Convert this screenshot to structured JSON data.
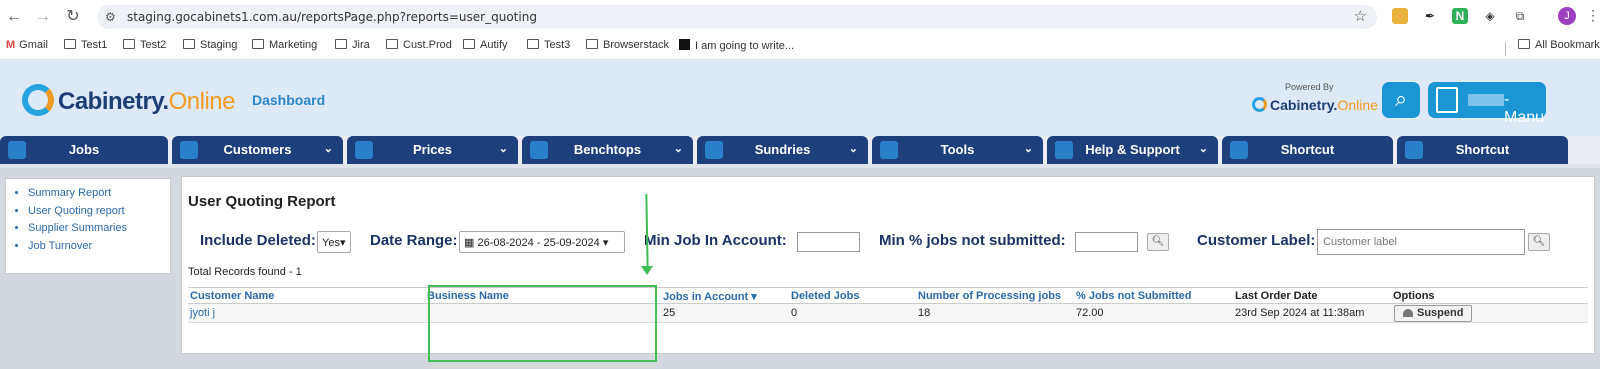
{
  "browser": {
    "url": "staging.gocabinets1.com.au/reportsPage.php?reports=user_quoting",
    "avatar_letter": "J",
    "bookmarks": [
      "Gmail",
      "Test1",
      "Test2",
      "Staging",
      "Marketing",
      "Jira",
      "Cust.Prod",
      "Autify",
      "Test3",
      "Browserstack",
      "I am going to write...",
      "All Bookmarks"
    ]
  },
  "header": {
    "logo_main": "Cabinetry.",
    "logo_accent": "Online",
    "dashboard_link": "Dashboard",
    "powered_by": "Powered By",
    "powered_logo_main": "Cabinetry.",
    "powered_logo_accent": "Online",
    "menu_label": "-Manu"
  },
  "nav": {
    "tabs": [
      {
        "label": "Jobs",
        "chevron": false
      },
      {
        "label": "Customers",
        "chevron": true
      },
      {
        "label": "Prices",
        "chevron": true
      },
      {
        "label": "Benchtops",
        "chevron": true
      },
      {
        "label": "Sundries",
        "chevron": true
      },
      {
        "label": "Tools",
        "chevron": true
      },
      {
        "label": "Help & Support",
        "chevron": true
      },
      {
        "label": "Shortcut",
        "chevron": false
      },
      {
        "label": "Shortcut",
        "chevron": false
      }
    ]
  },
  "sidebar": {
    "items": [
      "Summary Report",
      "User Quoting report",
      "Supplier Summaries",
      "Job Turnover"
    ]
  },
  "report": {
    "title": "User Quoting Report",
    "filters": {
      "include_deleted_label": "Include Deleted:",
      "include_deleted_value": "Yes",
      "date_range_label": "Date Range:",
      "date_range_value": "26-08-2024 - 25-09-2024",
      "min_job_label": "Min Job In Account:",
      "min_job_value": "",
      "min_pct_label": "Min % jobs not submitted:",
      "min_pct_value": "",
      "customer_label_label": "Customer Label:",
      "customer_label_placeholder": "Customer label"
    },
    "total_records": "Total Records found - 1",
    "columns": [
      "Customer Name",
      "Business Name",
      "Jobs in Account",
      "Deleted Jobs",
      "Number of Processing jobs",
      "% Jobs not Submitted",
      "Last Order Date",
      "Options"
    ],
    "rows": [
      {
        "customer_name": "jyoti j",
        "business_name": "",
        "jobs_in_account": "25",
        "deleted_jobs": "0",
        "processing_jobs": "18",
        "pct_not_submitted": "72.00",
        "last_order_date": "23rd Sep 2024 at 11:38am",
        "option_label": "Suspend"
      }
    ]
  },
  "colors": {
    "nav_tab": "#1d3f7c",
    "accent_blue": "#1a96d5",
    "annotation_green": "#3fbf55",
    "link_blue": "#2b6aa6"
  }
}
